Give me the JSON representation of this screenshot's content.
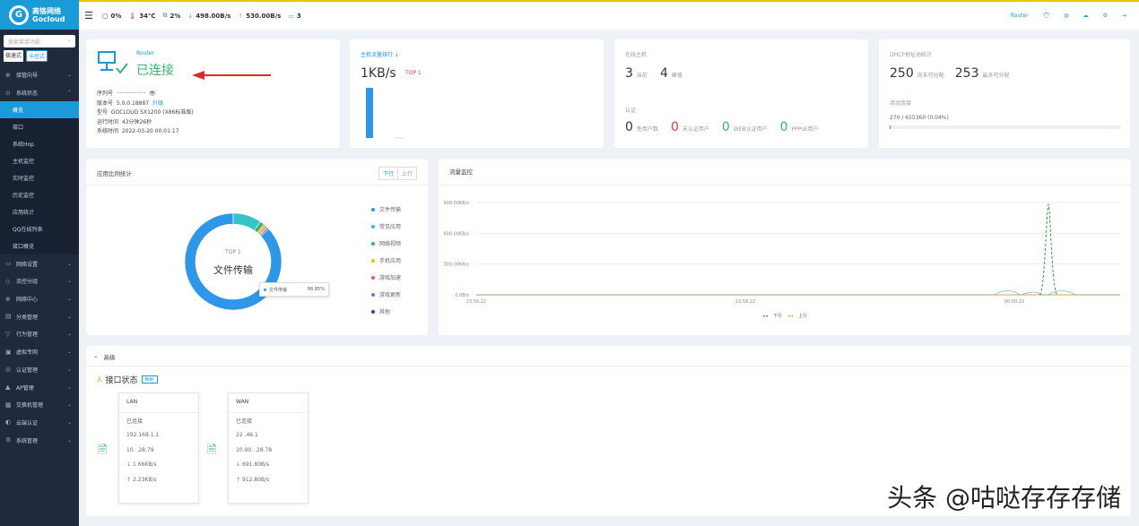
{
  "brand": {
    "name_cn": "高恪网络",
    "name_en": "Gocloud"
  },
  "sidebar": {
    "search_placeholder": "搜索菜单功能",
    "modes": [
      "极速式",
      "卡控式"
    ],
    "items": [
      {
        "label": "接管向导",
        "icon": "⊕",
        "sub": []
      },
      {
        "label": "系统状态",
        "icon": "⊙",
        "expanded": true,
        "sub": [
          "概览",
          "接口",
          "系统Hop",
          "主机监控",
          "实时监控",
          "历史监控",
          "应用统计",
          "QQ在线列表",
          "接口概览"
        ]
      },
      {
        "label": "网络设置",
        "icon": "▭"
      },
      {
        "label": "流控分组",
        "icon": "◇"
      },
      {
        "label": "网络中心",
        "icon": "⊕"
      },
      {
        "label": "分类管理",
        "icon": "▤"
      },
      {
        "label": "行为管理",
        "icon": "▽"
      },
      {
        "label": "虚拟专网",
        "icon": "▣"
      },
      {
        "label": "认证管理",
        "icon": "◎"
      },
      {
        "label": "AP管理",
        "icon": "▲"
      },
      {
        "label": "交换机管理",
        "icon": "▦"
      },
      {
        "label": "云端认证",
        "icon": "◐"
      },
      {
        "label": "系统管理",
        "icon": "⚙"
      }
    ]
  },
  "topbar": {
    "cpu": "0%",
    "temp": "34℃",
    "mem": "2%",
    "down": "498.00B/s",
    "up": "530.00B/s",
    "hosts": "3",
    "router": "Router"
  },
  "router_card": {
    "title": "Router",
    "status": "已连接",
    "serial_label": "序列号",
    "serial": "·················",
    "ver_label": "版本号",
    "ver": "5.0.0.18887",
    "upgrade": "升级",
    "model_label": "型号",
    "model": "GOCLOUD SX1200 (X86标准版)",
    "uptime_label": "运行时间",
    "uptime": "43分钟26秒",
    "systime_label": "系统时间",
    "systime": "2022-03-20 00:01:17"
  },
  "traffic_card": {
    "title": "主机流量排行 ↓",
    "value": "1KB/s",
    "badge": "TOP 1"
  },
  "online_card": {
    "title": "在线主机",
    "current": "3",
    "current_label": "当前",
    "peak": "4",
    "peak_label": "峰值",
    "auth_title": "认证",
    "auth": [
      {
        "n": "0",
        "label": "免用户数",
        "color": "#333"
      },
      {
        "n": "0",
        "label": "未认证用户",
        "color": "#e53935"
      },
      {
        "n": "0",
        "label": "WEB认证用户",
        "color": "#3cb371"
      },
      {
        "n": "0",
        "label": "PPPoE用户",
        "color": "#3cb371"
      }
    ]
  },
  "dhcp_card": {
    "title": "DHCP地址池统计",
    "avail": "250",
    "avail_label": "尚未可分配",
    "total": "253",
    "total_label": "最多可分配",
    "conn_title": "活动连接",
    "conn": "270 / 655360 (0.04%)",
    "conn_fraction": 0.0004
  },
  "app_card": {
    "title": "应用比例统计",
    "tabs": [
      "下行",
      "上行"
    ],
    "center_top": "TOP 1",
    "center_main": "文件传输",
    "tooltip_label": "文件传输",
    "tooltip_value": "86.85%",
    "legend": [
      {
        "label": "文件传输",
        "color": "#2f96e8"
      },
      {
        "label": "常见应用",
        "color": "#35c3c8"
      },
      {
        "label": "网络视频",
        "color": "#3cb371"
      },
      {
        "label": "手机应用",
        "color": "#f2c200"
      },
      {
        "label": "游戏加速",
        "color": "#e55a4e"
      },
      {
        "label": "游戏更新",
        "color": "#9b5de5"
      },
      {
        "label": "其他",
        "color": "#3b3fa8"
      }
    ]
  },
  "flow_card": {
    "title": "流量监控",
    "yticks": [
      "900.00KB/s",
      "600.00KB/s",
      "300.00KB/s",
      "0.0B/s"
    ],
    "xticks": [
      "23:56:22",
      "23:58:22",
      "00:00:22"
    ],
    "legend_down": "下行",
    "legend_up": "上行"
  },
  "advanced": {
    "label": "高级",
    "iface_title": "接口状态",
    "iface_tag": "映射",
    "cards": [
      {
        "title": "LAN",
        "status": "已连接",
        "ip1": "192.168.1.1",
        "ip2": "10.          .28.79",
        "down": "1.66KB/s",
        "up": "2.23KB/s"
      },
      {
        "title": "WAN",
        "status": "已连接",
        "ip1": "22         .46.1",
        "ip2": "10.90.       .28.78",
        "down": "691.80B/s",
        "up": "912.80B/s"
      }
    ]
  },
  "watermark": "头条 @咕哒存存存储",
  "chart_data": [
    {
      "type": "pie",
      "title": "应用比例统计",
      "categories": [
        "文件传输",
        "常见应用",
        "网络视频",
        "手机应用",
        "游戏加速",
        "游戏更新",
        "其他"
      ],
      "values": [
        86.85,
        9.5,
        1.5,
        0.8,
        0.5,
        0.4,
        0.45
      ]
    },
    {
      "type": "bar",
      "title": "主机流量排行",
      "categories": [
        "TOP 1"
      ],
      "values": [
        1
      ]
    }
  ]
}
